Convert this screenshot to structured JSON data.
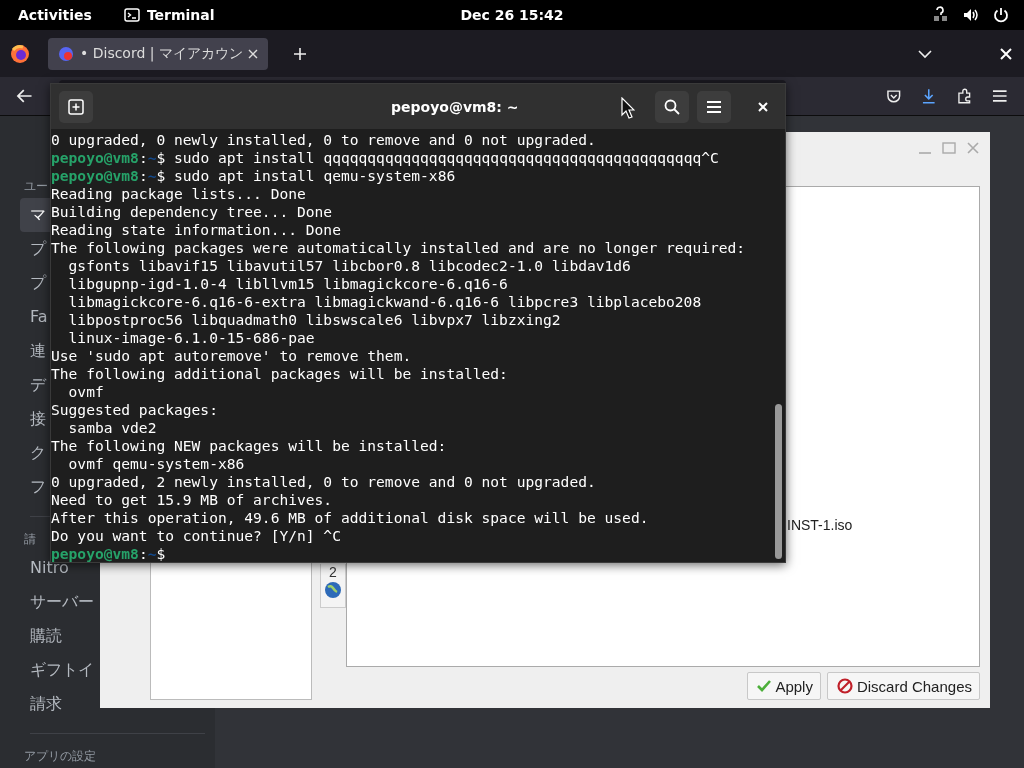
{
  "top_bar": {
    "activities": "Activities",
    "app": "Terminal",
    "clock": "Dec 26  15:42"
  },
  "browser": {
    "tabs": [
      {
        "label": "• Discord | マイアカウン",
        "selected": true
      }
    ]
  },
  "sidebar": {
    "sections": [
      {
        "header": "ユー",
        "items": [
          {
            "label": "マ",
            "selected": true
          },
          {
            "label": "プ",
            "selected": false
          },
          {
            "label": "プ",
            "selected": false
          },
          {
            "label": "Fa",
            "selected": false
          },
          {
            "label": "連",
            "selected": false
          },
          {
            "label": "デ",
            "selected": false
          },
          {
            "label": "接",
            "selected": false
          },
          {
            "label": "ク",
            "selected": false
          },
          {
            "label": "フ",
            "selected": false
          }
        ]
      },
      {
        "header": "請",
        "items": [
          {
            "label": "Nitro",
            "selected": false
          },
          {
            "label": "サーバー",
            "selected": false
          },
          {
            "label": "購読",
            "selected": false
          },
          {
            "label": "ギフトイ",
            "selected": false
          },
          {
            "label": "請求",
            "selected": false
          }
        ]
      },
      {
        "header": "アプリの設定"
      }
    ]
  },
  "dialog": {
    "tab_label": "2",
    "file_name": "INST-1.iso",
    "buttons": [
      {
        "label": "Apply",
        "kind": "apply"
      },
      {
        "label": "Discard Changes",
        "kind": "discard"
      }
    ]
  },
  "terminal": {
    "title": "pepoyo@vm8: ~",
    "lines": [
      {
        "kind": "output",
        "text": "0 upgraded, 0 newly installed, 0 to remove and 0 not upgraded."
      },
      {
        "kind": "prompt",
        "user": "pepoyo@vm8",
        "sep": ":",
        "path": "~",
        "command": "$ sudo apt install qqqqqqqqqqqqqqqqqqqqqqqqqqqqqqqqqqqqqqqqqqq^C"
      },
      {
        "kind": "prompt",
        "user": "pepoyo@vm8",
        "sep": ":",
        "path": "~",
        "command": "$ sudo apt install qemu-system-x86"
      },
      {
        "kind": "output",
        "text": "Reading package lists... Done"
      },
      {
        "kind": "output",
        "text": "Building dependency tree... Done"
      },
      {
        "kind": "output",
        "text": "Reading state information... Done"
      },
      {
        "kind": "output",
        "text": "The following packages were automatically installed and are no longer required:"
      },
      {
        "kind": "output",
        "text": "  gsfonts libavif15 libavutil57 libcbor0.8 libcodec2-1.0 libdav1d6"
      },
      {
        "kind": "output",
        "text": "  libgupnp-igd-1.0-4 libllvm15 libmagickcore-6.q16-6"
      },
      {
        "kind": "output",
        "text": "  libmagickcore-6.q16-6-extra libmagickwand-6.q16-6 libpcre3 libplacebo208"
      },
      {
        "kind": "output",
        "text": "  libpostproc56 libquadmath0 libswscale6 libvpx7 libzxing2"
      },
      {
        "kind": "output",
        "text": "  linux-image-6.1.0-15-686-pae"
      },
      {
        "kind": "output",
        "text": "Use 'sudo apt autoremove' to remove them."
      },
      {
        "kind": "output",
        "text": "The following additional packages will be installed:"
      },
      {
        "kind": "output",
        "text": "  ovmf"
      },
      {
        "kind": "output",
        "text": "Suggested packages:"
      },
      {
        "kind": "output",
        "text": "  samba vde2"
      },
      {
        "kind": "output",
        "text": "The following NEW packages will be installed:"
      },
      {
        "kind": "output",
        "text": "  ovmf qemu-system-x86"
      },
      {
        "kind": "output",
        "text": "0 upgraded, 2 newly installed, 0 to remove and 0 not upgraded."
      },
      {
        "kind": "output",
        "text": "Need to get 15.9 MB of archives."
      },
      {
        "kind": "output",
        "text": "After this operation, 49.6 MB of additional disk space will be used."
      },
      {
        "kind": "output",
        "text": "Do you want to continue? [Y/n] ^C"
      },
      {
        "kind": "prompt",
        "user": "pepoyo@vm8",
        "sep": ":",
        "path": "~",
        "command": "$ "
      }
    ]
  }
}
